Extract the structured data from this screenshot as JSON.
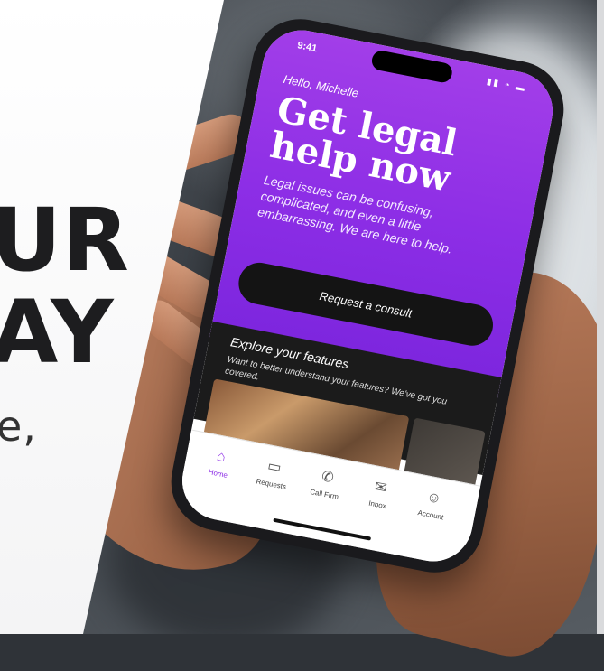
{
  "left_panel": {
    "line1": "UR",
    "line2": "AY",
    "line3": "e,"
  },
  "phone": {
    "status_time": "9:41",
    "status_icons": "▮▮ ◔ ▬",
    "greeting": "Hello, Michelle",
    "headline": "Get legal help now",
    "subcopy": "Legal issues can be confusing, complicated, and even a little embarrassing. We are here to help.",
    "cta_label": "Request a consult",
    "features_title": "Explore your features",
    "features_sub": "Want to better understand your features? We've got you covered.",
    "tabs": [
      {
        "label": "Home",
        "icon": "home-icon",
        "glyph": "⌂"
      },
      {
        "label": "Requests",
        "icon": "folder-icon",
        "glyph": "▭"
      },
      {
        "label": "Call Firm",
        "icon": "phone-icon",
        "glyph": "✆"
      },
      {
        "label": "Inbox",
        "icon": "inbox-icon",
        "glyph": "✉"
      },
      {
        "label": "Account",
        "icon": "account-icon",
        "glyph": "☺"
      }
    ]
  },
  "colors": {
    "brand_purple": "#8d2ee6",
    "cta_black": "#141414"
  }
}
